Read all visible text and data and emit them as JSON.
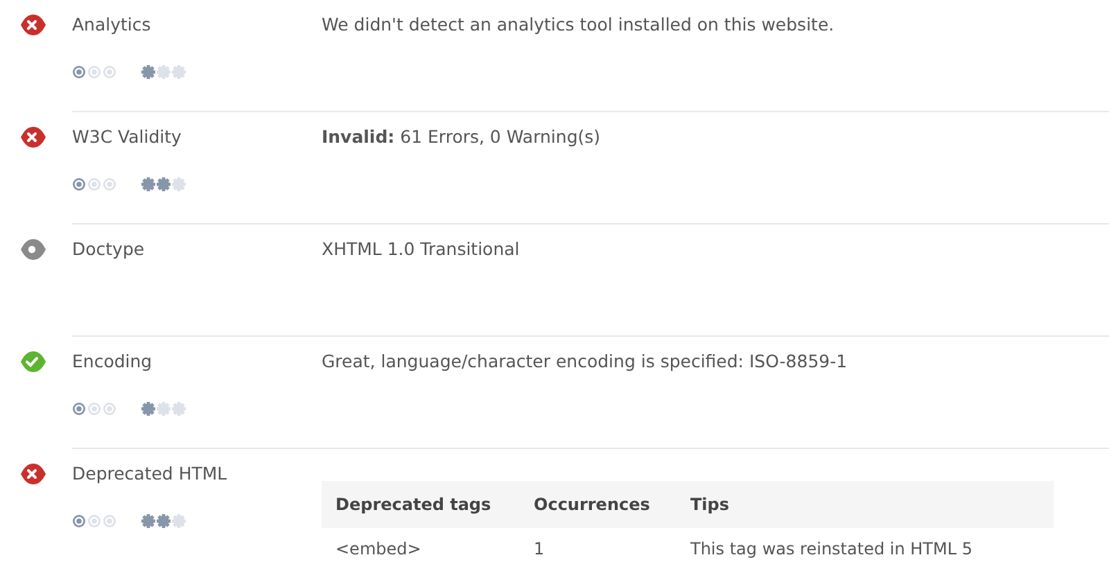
{
  "checks": [
    {
      "kind": "error",
      "label": "Analytics",
      "text": "We didn't detect an analytics tool installed on this website.",
      "ratings": [
        {
          "kind": "circle",
          "stars": 1
        },
        {
          "kind": "gear",
          "stars": 1
        }
      ]
    },
    {
      "kind": "error",
      "label": "W3C Validity",
      "text": "**Invalid:** 61 Errors, 0 Warning(s)",
      "ratings": [
        {
          "kind": "circle",
          "stars": 1
        },
        {
          "kind": "gear",
          "stars": 2
        }
      ]
    },
    {
      "kind": "info",
      "label": "Doctype",
      "text": "XHTML 1.0 Transitional"
    },
    {
      "kind": "pass",
      "label": "Encoding",
      "text": "Great, language/character encoding is specified: ISO-8859-1",
      "ratings": [
        {
          "kind": "circle",
          "stars": 1
        },
        {
          "kind": "gear",
          "stars": 1
        }
      ]
    },
    {
      "kind": "error",
      "label": "Deprecated HTML",
      "table": {
        "columns": [
          "Deprecated tags",
          "Occurrences",
          "Tips"
        ],
        "rows": [
          [
            "<embed>",
            "1",
            "This tag was reinstated in HTML 5"
          ]
        ]
      },
      "ratings": [
        {
          "kind": "circle",
          "stars": 1
        },
        {
          "kind": "gear",
          "stars": 2
        }
      ]
    }
  ]
}
